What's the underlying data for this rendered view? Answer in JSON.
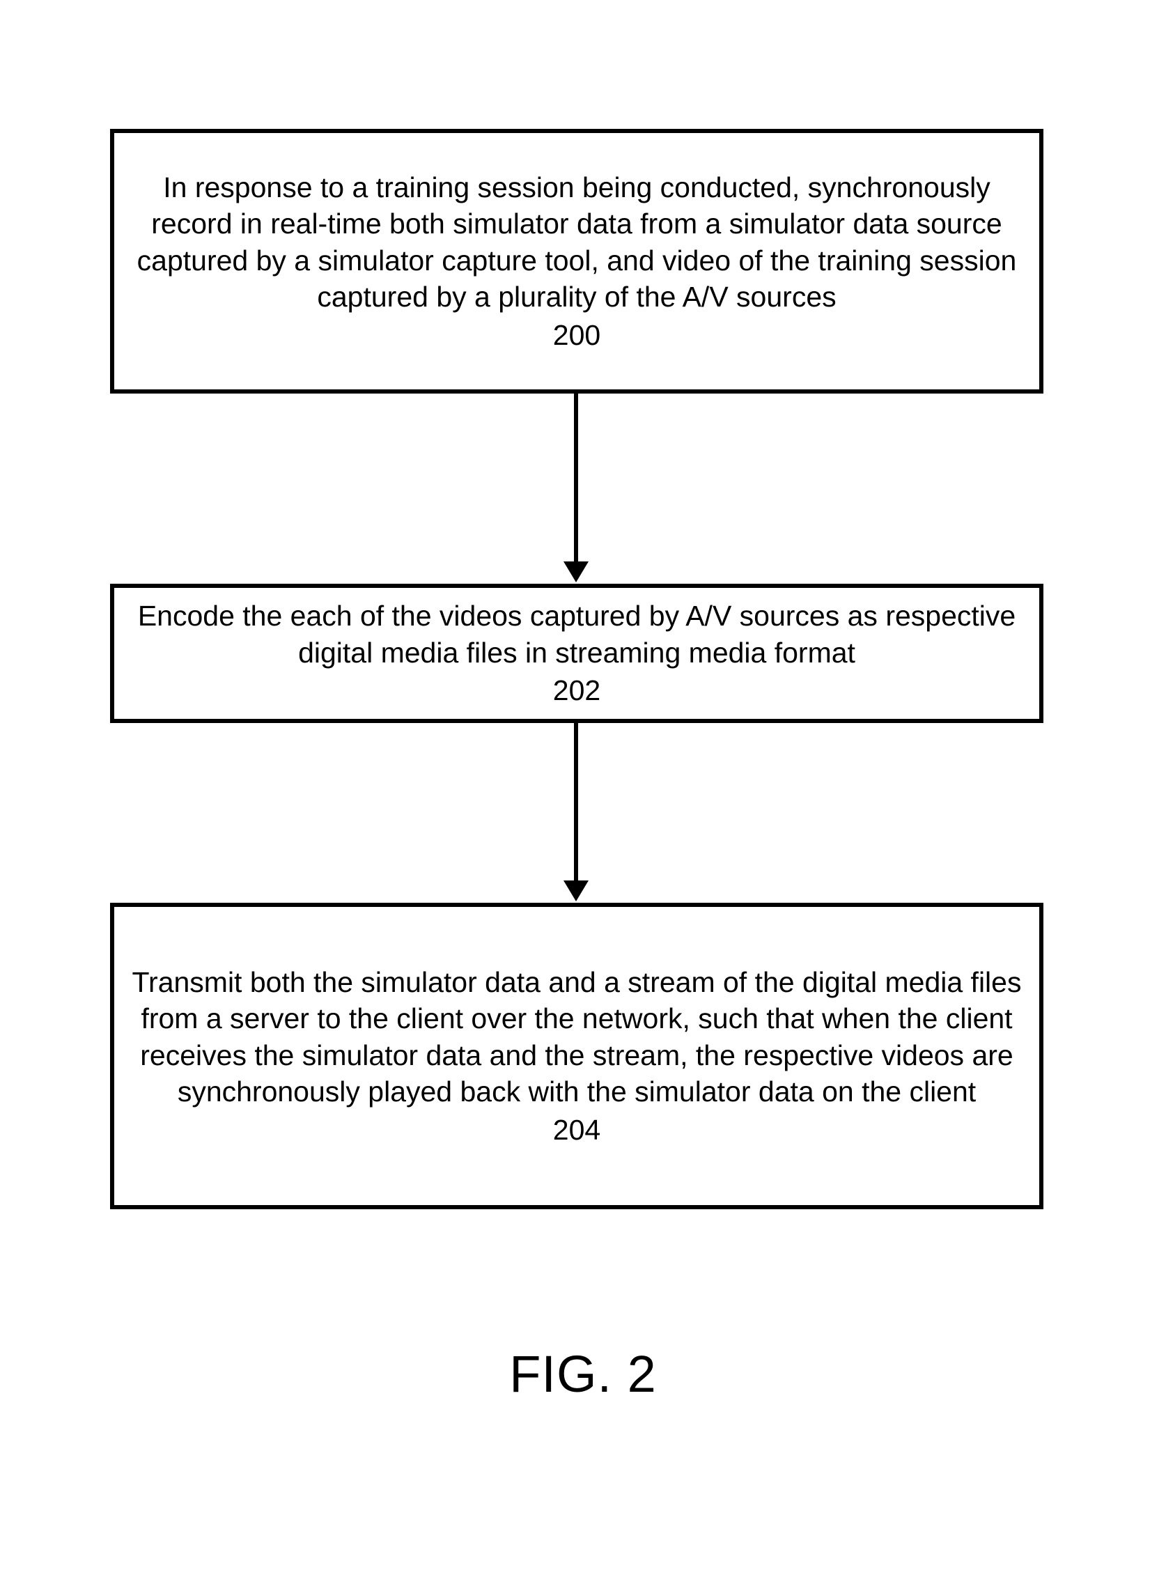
{
  "figure_label": "FIG. 2",
  "steps": {
    "s200": {
      "text": "In response to a training session being conducted, synchronously record in real-time both simulator data from a simulator data source captured by a simulator capture tool, and video of the training session captured by a plurality of the A/V sources",
      "ref": "200"
    },
    "s202": {
      "text": "Encode the each of the videos captured by A/V sources as respective digital media files in streaming media format",
      "ref": "202"
    },
    "s204": {
      "text": "Transmit both the simulator data and a stream of the digital media files from a server to the client over the network, such that when the client receives the simulator data and the stream, the respective videos are synchronously played back with the simulator data on the client",
      "ref": "204"
    }
  }
}
